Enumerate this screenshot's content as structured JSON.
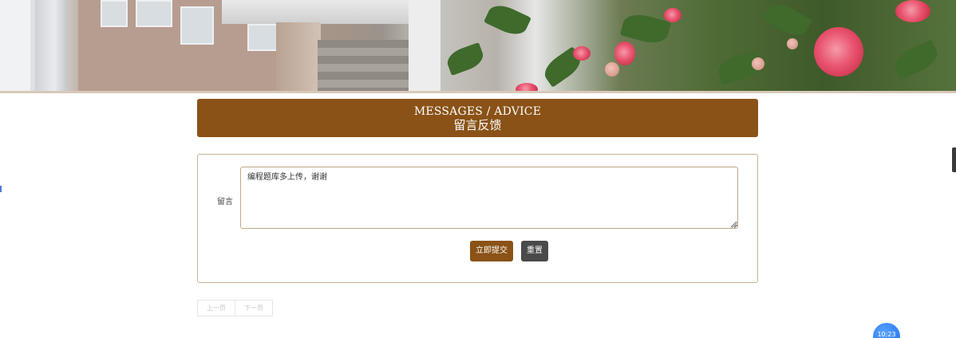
{
  "banner": {
    "image_name": "campus-camellia-banner"
  },
  "header": {
    "title_en": "MESSAGES / ADVICE",
    "title_cn": "留言反馈"
  },
  "form": {
    "label": "留言",
    "message_value": "编程题库多上传，谢谢",
    "submit_label": "立即提交",
    "reset_label": "重置"
  },
  "pagination": {
    "prev_label": "上一页",
    "next_label": "下一页"
  },
  "floating": {
    "time": "10:23"
  },
  "colors": {
    "accent": "#8a5216",
    "reset": "#4a4a4a",
    "border": "#c7b394"
  }
}
